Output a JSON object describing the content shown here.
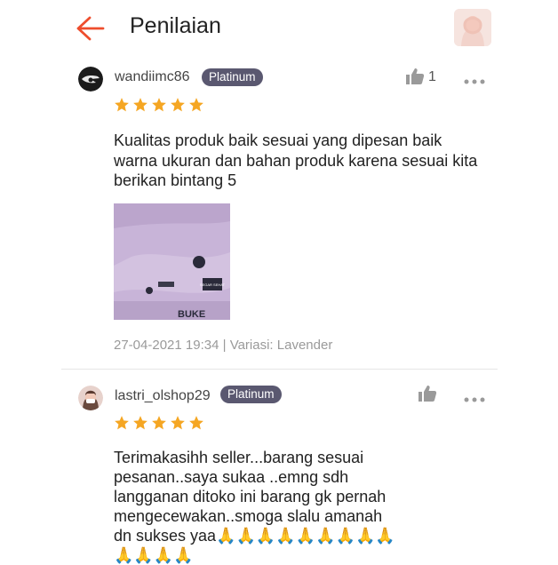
{
  "header": {
    "title": "Penilaian"
  },
  "reviews": [
    {
      "username": "wandiimc86",
      "badge": "Platinum",
      "likes": "1",
      "rating": 5,
      "text": "Kualitas produk baik sesuai yang dipesan baik warna ukuran dan bahan produk karena sesuai kita berikan bintang 5",
      "date": "27-04-2021 19:34",
      "variation": "Variasi: Lavender",
      "photo_labels": [
        "SEGAR SEHAT",
        "BUKE"
      ]
    },
    {
      "username": "lastri_olshop29",
      "badge": "Platinum",
      "rating": 5,
      "text": "Terimakasihh seller...barang sesuai pesanan..saya sukaa ..emng sdh langganan ditoko ini barang gk pernah mengecewakan..smoga slalu amanah dn sukses yaa🙏🙏🙏🙏🙏🙏🙏🙏🙏🙏🙏🙏🙏"
    }
  ],
  "colors": {
    "accent": "#ee4d2d",
    "star": "#f5a623",
    "badge_bg": "#5a5870"
  },
  "icons": [
    "back-arrow-icon",
    "thumbs-up-icon",
    "more-options-icon",
    "star-icon"
  ]
}
